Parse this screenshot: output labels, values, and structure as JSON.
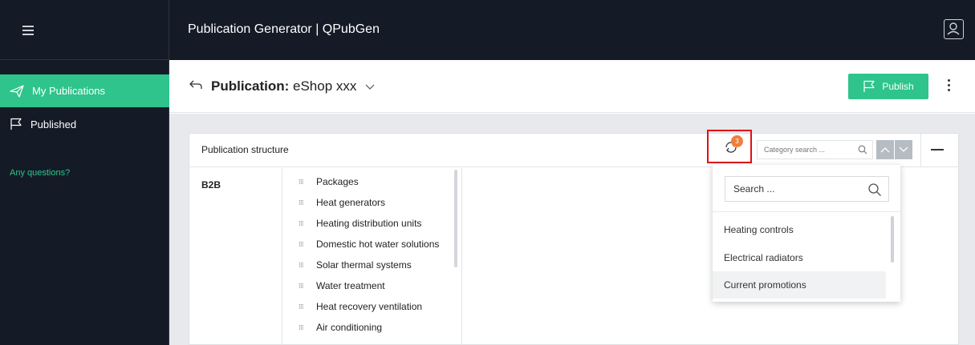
{
  "app": {
    "title": "Publication Generator | QPubGen"
  },
  "sidebar": {
    "items": [
      {
        "label": "My Publications",
        "icon": "paper-plane-icon",
        "active": true
      },
      {
        "label": "Published",
        "icon": "flag-icon",
        "active": false
      }
    ],
    "help_link": "Any questions?"
  },
  "header": {
    "title_prefix": "Publication:",
    "publication_name": "eShop xxx",
    "publish_label": "Publish"
  },
  "panel": {
    "title": "Publication structure",
    "sync_badge_count": "3",
    "category_search_placeholder": "Category search ...",
    "root_label": "B2B",
    "categories": [
      "Packages",
      "Heat generators",
      "Heating distribution units",
      "Domestic hot water solutions",
      "Solar thermal systems",
      "Water treatment",
      "Heat recovery ventilation",
      "Air conditioning"
    ]
  },
  "dropdown": {
    "search_placeholder": "Search ...",
    "items": [
      "Heating controls",
      "Electrical radiators",
      "Current promotions"
    ],
    "highlighted_index": 2
  },
  "colors": {
    "topbar_bg": "#141b26",
    "accent": "#2ec48c",
    "badge": "#f07e3c",
    "highlight_border": "#e01010"
  }
}
